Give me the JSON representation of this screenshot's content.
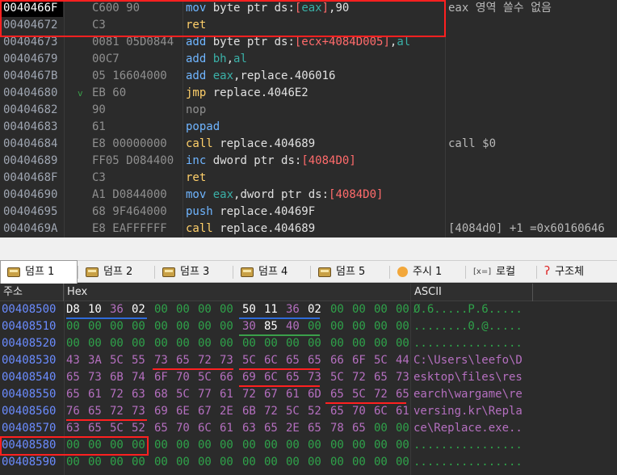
{
  "disasm": {
    "rows": [
      {
        "addr": "0040466F",
        "bytes": "C600 90",
        "arrow": "",
        "mn": "mov",
        "ops": [
          [
            "plain",
            " byte ptr ds:"
          ],
          [
            "mem",
            "["
          ],
          [
            "reg",
            "eax"
          ],
          [
            "mem",
            "]"
          ],
          [
            "plain",
            ",90"
          ]
        ],
        "comment": "eax 영역 쓸수 없음"
      },
      {
        "addr": "00404672",
        "bytes": "C3",
        "arrow": "",
        "mn": "ret",
        "ops": [],
        "comment": ""
      },
      {
        "addr": "00404673",
        "bytes": "0081 05D0844",
        "arrow": "",
        "mn": "add",
        "ops": [
          [
            "plain",
            " byte ptr ds:"
          ],
          [
            "mem",
            "[ecx+4084D005]"
          ],
          [
            "plain",
            ","
          ],
          [
            "reg",
            "al"
          ]
        ],
        "comment": ""
      },
      {
        "addr": "00404679",
        "bytes": "00C7",
        "arrow": "",
        "mn": "add",
        "ops": [
          [
            "reg",
            " bh"
          ],
          [
            "plain",
            ","
          ],
          [
            "reg",
            "al"
          ]
        ],
        "comment": ""
      },
      {
        "addr": "0040467B",
        "bytes": "05 16604000",
        "arrow": "",
        "mn": "add",
        "ops": [
          [
            "reg",
            " eax"
          ],
          [
            "plain",
            ","
          ],
          [
            "sym",
            "replace.406016"
          ]
        ],
        "comment": ""
      },
      {
        "addr": "00404680",
        "bytes": "EB 60",
        "arrow": "v",
        "mn": "jmp",
        "ops": [
          [
            "sym",
            " replace.4046E2"
          ]
        ],
        "comment": ""
      },
      {
        "addr": "00404682",
        "bytes": "90",
        "arrow": "",
        "mn": "nop",
        "ops": [],
        "comment": ""
      },
      {
        "addr": "00404683",
        "bytes": "61",
        "arrow": "",
        "mn": "popad",
        "ops": [],
        "comment": ""
      },
      {
        "addr": "00404684",
        "bytes": "E8 00000000",
        "arrow": "",
        "mn": "call",
        "ops": [
          [
            "sym",
            " replace.404689"
          ]
        ],
        "comment": "call $0"
      },
      {
        "addr": "00404689",
        "bytes": "FF05 D084400",
        "arrow": "",
        "mn": "inc",
        "ops": [
          [
            "plain",
            " dword ptr ds:"
          ],
          [
            "mem",
            "[4084D0]"
          ]
        ],
        "comment": ""
      },
      {
        "addr": "0040468F",
        "bytes": "C3",
        "arrow": "",
        "mn": "ret",
        "ops": [],
        "comment": ""
      },
      {
        "addr": "00404690",
        "bytes": "A1 D0844000",
        "arrow": "",
        "mn": "mov",
        "ops": [
          [
            "reg",
            " eax"
          ],
          [
            "plain",
            ",dword ptr ds:"
          ],
          [
            "mem",
            "[4084D0]"
          ]
        ],
        "comment": ""
      },
      {
        "addr": "00404695",
        "bytes": "68 9F464000",
        "arrow": "",
        "mn": "push",
        "ops": [
          [
            "sym",
            " replace.40469F"
          ]
        ],
        "comment": ""
      },
      {
        "addr": "0040469A",
        "bytes": "E8 EAFFFFFF",
        "arrow": "",
        "mn": "call",
        "ops": [
          [
            "sym",
            " replace.404689"
          ]
        ],
        "comment": "[4084d0] +1 =0x60160646"
      }
    ]
  },
  "tabs": [
    {
      "label": "덤프 1",
      "icon": "dump-icon",
      "active": true
    },
    {
      "label": "덤프 2",
      "icon": "dump-icon",
      "active": false
    },
    {
      "label": "덤프 3",
      "icon": "dump-icon",
      "active": false
    },
    {
      "label": "덤프 4",
      "icon": "dump-icon",
      "active": false
    },
    {
      "label": "덤프 5",
      "icon": "dump-icon",
      "active": false
    },
    {
      "label": "주시 1",
      "icon": "watch-icon",
      "active": false
    },
    {
      "label": "로컬",
      "icon": "locals-icon",
      "icon_text": "[x=]",
      "active": false
    },
    {
      "label": "구조체",
      "icon": "struct-icon",
      "icon_text": "ʔ",
      "active": false
    }
  ],
  "dump": {
    "headers": {
      "addr": "주소",
      "hex": "Hex",
      "ascii": "ASCII"
    },
    "rows": [
      {
        "addr": "00408500",
        "bytes": [
          "D8",
          "10",
          "36",
          "02",
          "00",
          "00",
          "00",
          "00",
          "50",
          "11",
          "36",
          "02",
          "00",
          "00",
          "00",
          "00"
        ],
        "ascii": "Ø.6.....P.6....."
      },
      {
        "addr": "00408510",
        "bytes": [
          "00",
          "00",
          "00",
          "00",
          "00",
          "00",
          "00",
          "00",
          "30",
          "85",
          "40",
          "00",
          "00",
          "00",
          "00",
          "00"
        ],
        "ascii": "........0.@....."
      },
      {
        "addr": "00408520",
        "bytes": [
          "00",
          "00",
          "00",
          "00",
          "00",
          "00",
          "00",
          "00",
          "00",
          "00",
          "00",
          "00",
          "00",
          "00",
          "00",
          "00"
        ],
        "ascii": "................"
      },
      {
        "addr": "00408530",
        "bytes": [
          "43",
          "3A",
          "5C",
          "55",
          "73",
          "65",
          "72",
          "73",
          "5C",
          "6C",
          "65",
          "65",
          "66",
          "6F",
          "5C",
          "44"
        ],
        "ascii": "C:\\Users\\leefo\\D"
      },
      {
        "addr": "00408540",
        "bytes": [
          "65",
          "73",
          "6B",
          "74",
          "6F",
          "70",
          "5C",
          "66",
          "69",
          "6C",
          "65",
          "73",
          "5C",
          "72",
          "65",
          "73"
        ],
        "ascii": "esktop\\files\\res"
      },
      {
        "addr": "00408550",
        "bytes": [
          "65",
          "61",
          "72",
          "63",
          "68",
          "5C",
          "77",
          "61",
          "72",
          "67",
          "61",
          "6D",
          "65",
          "5C",
          "72",
          "65"
        ],
        "ascii": "earch\\wargame\\re"
      },
      {
        "addr": "00408560",
        "bytes": [
          "76",
          "65",
          "72",
          "73",
          "69",
          "6E",
          "67",
          "2E",
          "6B",
          "72",
          "5C",
          "52",
          "65",
          "70",
          "6C",
          "61"
        ],
        "ascii": "versing.kr\\Repla"
      },
      {
        "addr": "00408570",
        "bytes": [
          "63",
          "65",
          "5C",
          "52",
          "65",
          "70",
          "6C",
          "61",
          "63",
          "65",
          "2E",
          "65",
          "78",
          "65",
          "00",
          "00"
        ],
        "ascii": "ce\\Replace.exe.."
      },
      {
        "addr": "00408580",
        "bytes": [
          "00",
          "00",
          "00",
          "00",
          "00",
          "00",
          "00",
          "00",
          "00",
          "00",
          "00",
          "00",
          "00",
          "00",
          "00",
          "00"
        ],
        "ascii": "................"
      },
      {
        "addr": "00408590",
        "bytes": [
          "00",
          "00",
          "00",
          "00",
          "00",
          "00",
          "00",
          "00",
          "00",
          "00",
          "00",
          "00",
          "00",
          "00",
          "00",
          "00"
        ],
        "ascii": "................"
      }
    ]
  },
  "colors": {
    "highlight_box": "#ff2020",
    "hex_green": "#2fa24a",
    "hex_purple": "#b46fbf",
    "addr_blue": "#6b8cff"
  }
}
